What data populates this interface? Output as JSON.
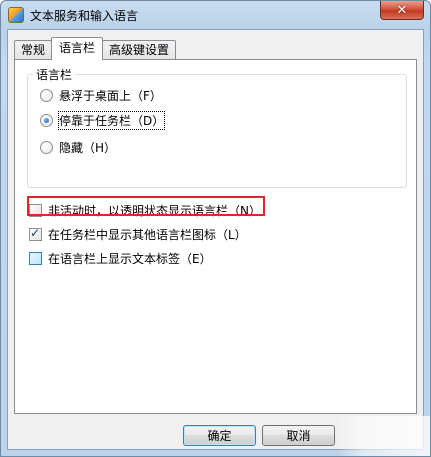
{
  "window": {
    "title": "文本服务和输入语言",
    "close_glyph": "✕"
  },
  "tabs": [
    {
      "label": "常规",
      "active": false
    },
    {
      "label": "语言栏",
      "active": true
    },
    {
      "label": "高级键设置",
      "active": false
    }
  ],
  "language_bar_group": {
    "legend": "语言栏",
    "options": [
      {
        "label": "悬浮于桌面上（F）",
        "checked": false
      },
      {
        "label": "停靠于任务栏（D）",
        "checked": true
      },
      {
        "label": "隐藏（H）",
        "checked": false
      }
    ]
  },
  "checkboxes": [
    {
      "label": "非活动时，以透明状态显示语言栏（N）",
      "checked": false
    },
    {
      "label": "在任务栏中显示其他语言栏图标（L）",
      "checked": true
    },
    {
      "label": "在语言栏上显示文本标签（E）",
      "checked": false
    }
  ],
  "buttons": {
    "ok": "确定",
    "cancel": "取消"
  },
  "colors": {
    "highlight": "#e2242b",
    "title_gradient": "#c9ddef"
  }
}
